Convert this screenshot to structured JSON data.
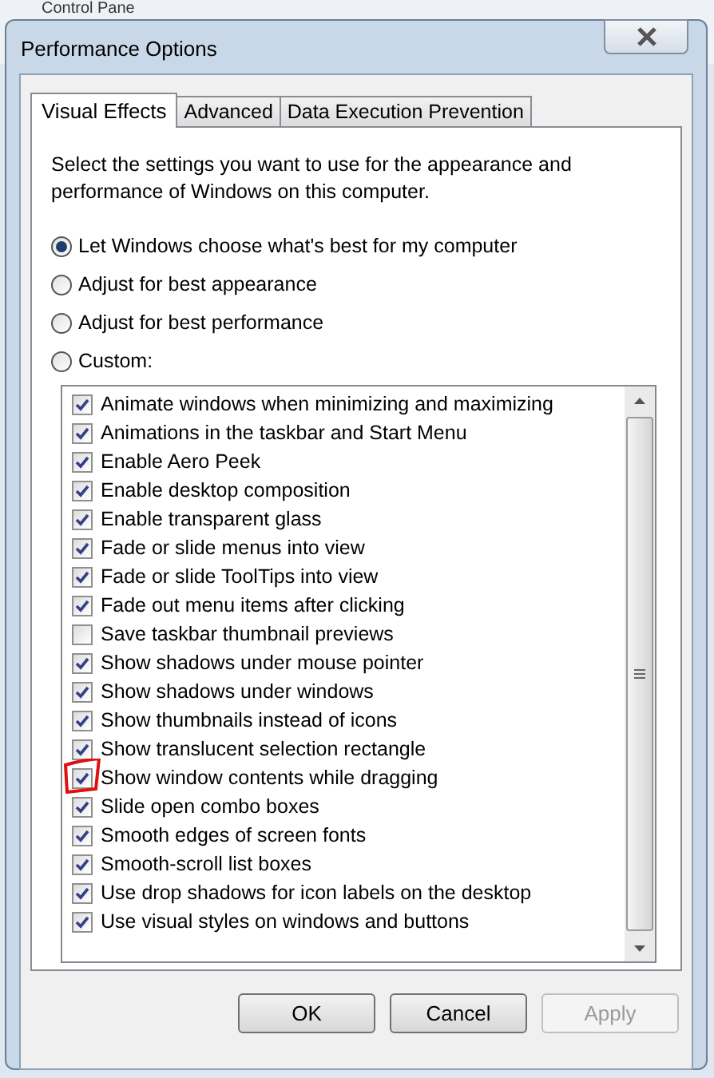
{
  "background_window": {
    "title": "Control Pane"
  },
  "window": {
    "title": "Performance Options"
  },
  "tabs": [
    {
      "label": "Visual Effects",
      "selected": true
    },
    {
      "label": "Advanced",
      "selected": false
    },
    {
      "label": "Data Execution Prevention",
      "selected": false
    }
  ],
  "description": "Select the settings you want to use for the appearance and performance of Windows on this computer.",
  "options": [
    {
      "label": "Let Windows choose what's best for my computer",
      "selected": true
    },
    {
      "label": "Adjust for best appearance",
      "selected": false
    },
    {
      "label": "Adjust for best performance",
      "selected": false
    },
    {
      "label": "Custom:",
      "selected": false
    }
  ],
  "effects": [
    {
      "label": "Animate windows when minimizing and maximizing",
      "checked": true
    },
    {
      "label": "Animations in the taskbar and Start Menu",
      "checked": true
    },
    {
      "label": "Enable Aero Peek",
      "checked": true
    },
    {
      "label": "Enable desktop composition",
      "checked": true
    },
    {
      "label": "Enable transparent glass",
      "checked": true
    },
    {
      "label": "Fade or slide menus into view",
      "checked": true
    },
    {
      "label": "Fade or slide ToolTips into view",
      "checked": true
    },
    {
      "label": "Fade out menu items after clicking",
      "checked": true
    },
    {
      "label": "Save taskbar thumbnail previews",
      "checked": false
    },
    {
      "label": "Show shadows under mouse pointer",
      "checked": true
    },
    {
      "label": "Show shadows under windows",
      "checked": true
    },
    {
      "label": "Show thumbnails instead of icons",
      "checked": true
    },
    {
      "label": "Show translucent selection rectangle",
      "checked": true
    },
    {
      "label": "Show window contents while dragging",
      "checked": true,
      "highlighted": true
    },
    {
      "label": "Slide open combo boxes",
      "checked": true
    },
    {
      "label": "Smooth edges of screen fonts",
      "checked": true
    },
    {
      "label": "Smooth-scroll list boxes",
      "checked": true
    },
    {
      "label": "Use drop shadows for icon labels on the desktop",
      "checked": true
    },
    {
      "label": "Use visual styles on windows and buttons",
      "checked": true
    }
  ],
  "buttons": [
    {
      "label": "OK",
      "disabled": false
    },
    {
      "label": "Cancel",
      "disabled": false
    },
    {
      "label": "Apply",
      "disabled": true
    }
  ]
}
